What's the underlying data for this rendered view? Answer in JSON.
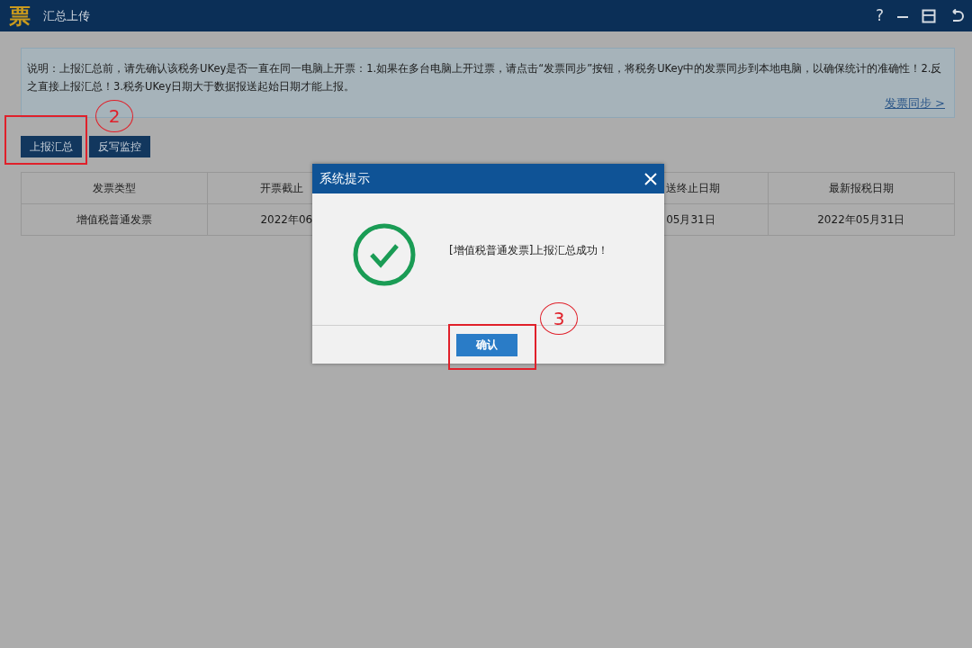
{
  "window": {
    "logo": "票",
    "title": "汇总上传",
    "help": "?"
  },
  "notice": {
    "text": "说明：上报汇总前，请先确认该税务UKey是否一直在同一电脑上开票：1.如果在多台电脑上开过票，请点击“发票同步”按钮，将税务UKey中的发票同步到本地电脑，以确保统计的准确性！2.反之直接上报汇总！3.税务UKey日期大于数据报送起始日期才能上报。",
    "link": "发票同步 >"
  },
  "toolbar": [
    "上报汇总",
    "反写监控"
  ],
  "table": {
    "columns": [
      "发票类型",
      "开票截止",
      "",
      "送终止日期",
      "最新报税日期"
    ],
    "rows": [
      [
        "增值税普通发票",
        "2022年06",
        "",
        "05月31日",
        "2022年05月31日"
      ]
    ]
  },
  "dialog": {
    "title": "系统提示",
    "message": "[增值税普通发票]上报汇总成功！",
    "button": "确认"
  },
  "annotations": [
    {
      "label": "2"
    },
    {
      "label": "3"
    }
  ]
}
